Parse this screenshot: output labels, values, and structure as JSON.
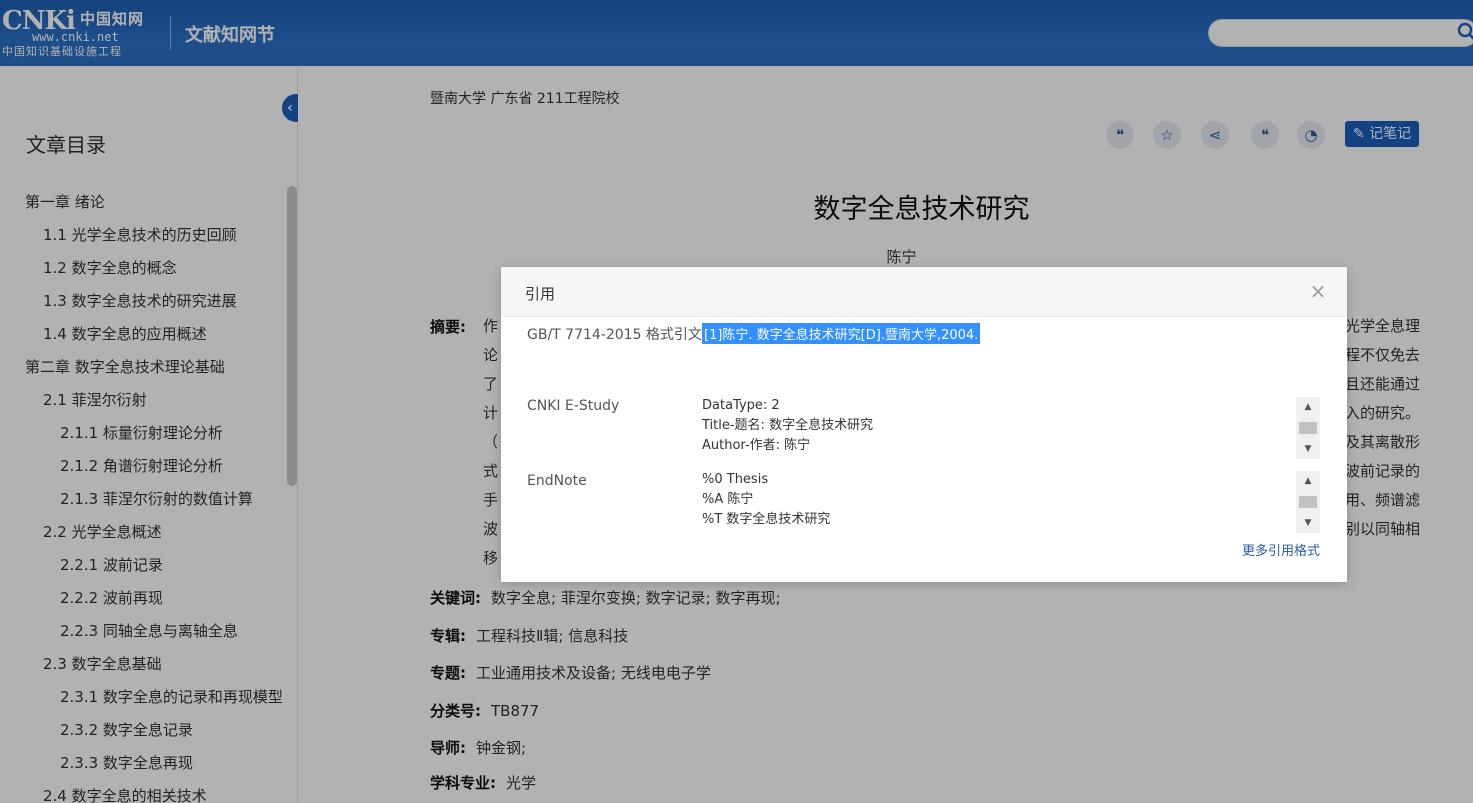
{
  "header": {
    "logo_main": "CNKi",
    "logo_cn": "中国知网",
    "logo_url": "www.cnki.net",
    "logo_sub": "中国知识基础设施工程",
    "section_title": "文献知网节"
  },
  "sidebar": {
    "toc_title": "文章目录",
    "items": [
      {
        "label": "第一章 绪论",
        "level": 1
      },
      {
        "label": "1.1 光学全息技术的历史回顾",
        "level": 2
      },
      {
        "label": "1.2 数字全息的概念",
        "level": 2
      },
      {
        "label": "1.3 数字全息技术的研究进展",
        "level": 2
      },
      {
        "label": "1.4 数字全息的应用概述",
        "level": 2
      },
      {
        "label": "第二章 数字全息技术理论基础",
        "level": 1
      },
      {
        "label": "2.1 菲涅尔衍射",
        "level": 2
      },
      {
        "label": "2.1.1 标量衍射理论分析",
        "level": 3
      },
      {
        "label": "2.1.2 角谱衍射理论分析",
        "level": 3
      },
      {
        "label": "2.1.3 菲涅尔衍射的数值计算",
        "level": 3
      },
      {
        "label": "2.2 光学全息概述",
        "level": 2
      },
      {
        "label": "2.2.1 波前记录",
        "level": 3
      },
      {
        "label": "2.2.2 波前再现",
        "level": 3
      },
      {
        "label": "2.2.3 同轴全息与离轴全息",
        "level": 3
      },
      {
        "label": "2.3 数字全息基础",
        "level": 2
      },
      {
        "label": "2.3.1 数字全息的记录和再现模型",
        "level": 3
      },
      {
        "label": "2.3.2 数字全息记录",
        "level": 3
      },
      {
        "label": "2.3.3 数字全息再现",
        "level": 3
      },
      {
        "label": "2.4 数字全息的相关技术",
        "level": 2
      }
    ]
  },
  "article": {
    "affiliation": "暨南大学  广东省 211工程院校",
    "note_button": "记笔记",
    "title": "数字全息技术研究",
    "author": "陈宁",
    "abstract_label": "摘要:",
    "abstract_lines": [
      "作",
      "论",
      "了",
      "计",
      "（",
      "式",
      "手",
      "波",
      "移"
    ],
    "abstract_right": [
      "光学全息理",
      "程不仅免去",
      "且还能通过",
      "入的研究。",
      "及其离散形",
      "波前记录的",
      "用、频谱滤",
      "别以同轴相",
      ""
    ],
    "keywords_label": "关键词:",
    "keywords": "数字全息;  菲涅尔变换;  数字记录;  数字再现;",
    "album_label": "专辑:",
    "album": "工程科技Ⅱ辑; 信息科技",
    "topic_label": "专题:",
    "topic": "工业通用技术及设备; 无线电电子学",
    "class_label": "分类号:",
    "class_no": "TB877",
    "advisor_label": "导师:",
    "advisor": "钟金钢;",
    "major_label": "学科专业:",
    "major": "光学"
  },
  "cite_dialog": {
    "title": "引用",
    "gbt_label": "GB/T 7714-2015 格式引文",
    "gbt_text": "[1]陈宁. 数字全息技术研究[D].暨南大学,2004.",
    "estudy_label": "CNKI E-Study",
    "estudy_lines": [
      "DataType: 2",
      "Title-题名: 数字全息技术研究",
      "Author-作者: 陈宁"
    ],
    "endnote_label": "EndNote",
    "endnote_lines": [
      "%0 Thesis",
      "%A 陈宁",
      "%T 数字全息技术研究"
    ],
    "more_link": "更多引用格式"
  }
}
